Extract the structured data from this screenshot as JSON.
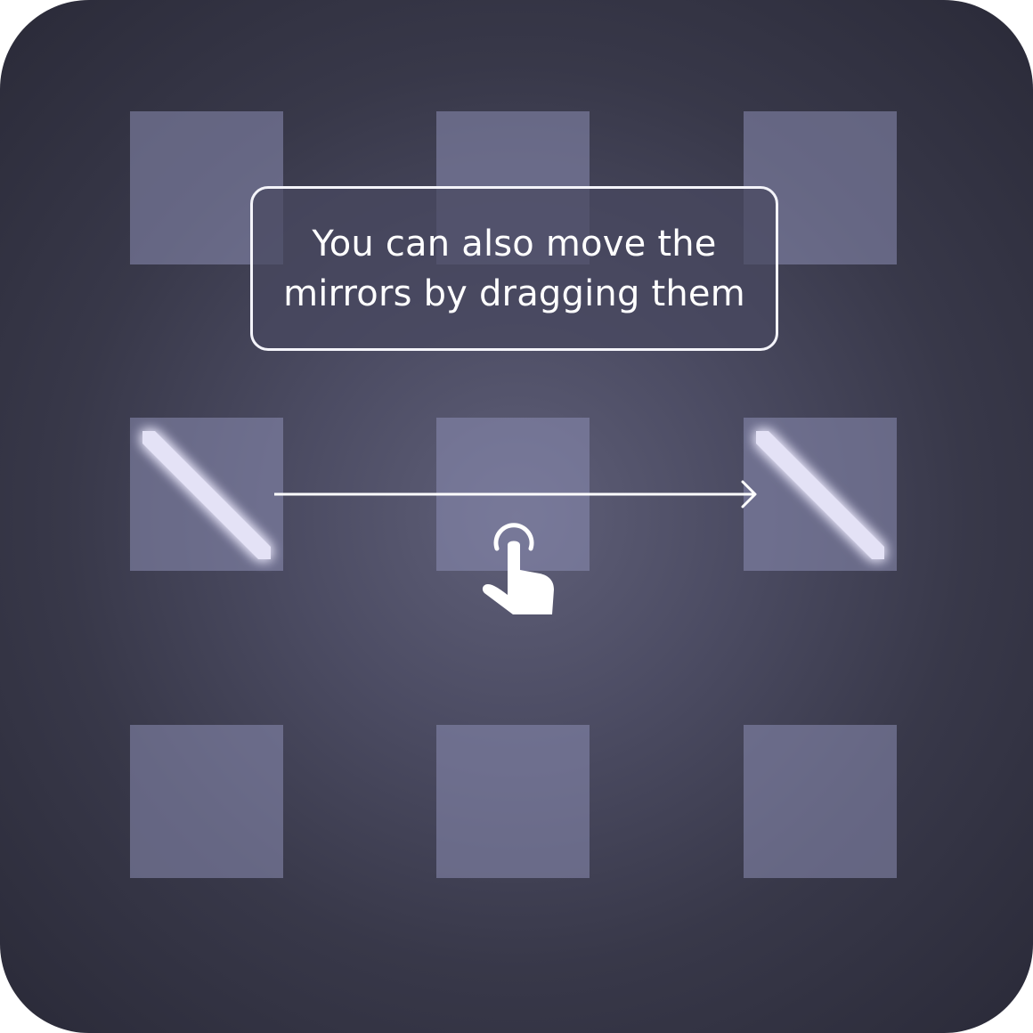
{
  "hint": {
    "line1": "You can also move the",
    "line2": "mirrors by dragging them"
  },
  "grid": {
    "rows": 3,
    "cols": 3,
    "cells": [
      {
        "row": 0,
        "col": 0,
        "mirror": null
      },
      {
        "row": 0,
        "col": 1,
        "mirror": null
      },
      {
        "row": 0,
        "col": 2,
        "mirror": null
      },
      {
        "row": 1,
        "col": 0,
        "mirror": "backslash"
      },
      {
        "row": 1,
        "col": 1,
        "mirror": null
      },
      {
        "row": 1,
        "col": 2,
        "mirror": "backslash"
      },
      {
        "row": 2,
        "col": 0,
        "mirror": null
      },
      {
        "row": 2,
        "col": 1,
        "mirror": null
      },
      {
        "row": 2,
        "col": 2,
        "mirror": null
      }
    ]
  },
  "drag_gesture": {
    "from": {
      "row": 1,
      "col": 0
    },
    "to": {
      "row": 1,
      "col": 2
    },
    "icon": "tap-hand-icon"
  },
  "colors": {
    "background": "#383849",
    "cell": "#8c8eb4",
    "mirror": "#e4e2f6",
    "mirror_glow": "#ffffff",
    "text": "#ffffff"
  }
}
